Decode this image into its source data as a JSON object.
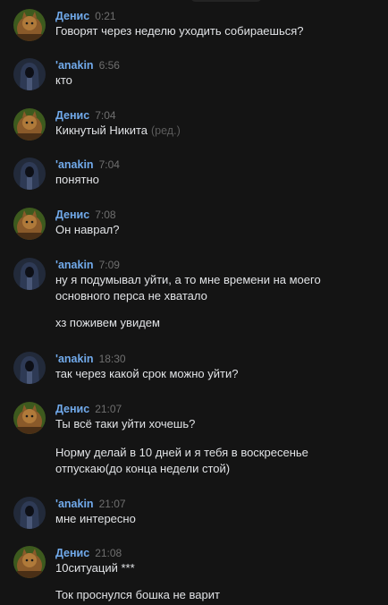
{
  "colors": {
    "background": "#141414",
    "author": "#71aaeb",
    "text": "#e1e3e6",
    "timestamp": "#6f6f6f"
  },
  "messages": [
    {
      "author": "Денис",
      "time": "0:21",
      "avatar": "cat-avatar",
      "lines": [
        "Говорят через неделю уходить собираешься?"
      ]
    },
    {
      "author": "'anakin",
      "time": "6:56",
      "avatar": "hooded-figure-avatar",
      "lines": [
        "кто"
      ]
    },
    {
      "author": "Денис",
      "time": "7:04",
      "avatar": "cat-avatar",
      "lines": [
        "Кикнутый Никита"
      ],
      "edited": "(ред.)"
    },
    {
      "author": "'anakin",
      "time": "7:04",
      "avatar": "hooded-figure-avatar",
      "lines": [
        "понятно"
      ]
    },
    {
      "author": "Денис",
      "time": "7:08",
      "avatar": "cat-avatar",
      "lines": [
        "Он наврал?"
      ]
    },
    {
      "author": "'anakin",
      "time": "7:09",
      "avatar": "hooded-figure-avatar",
      "lines": [
        "ну я подумывал уйти, а то мне времени на моего",
        "основного перса не хватало",
        "хз поживем увидем"
      ]
    },
    {
      "author": "'anakin",
      "time": "18:30",
      "avatar": "hooded-figure-avatar",
      "lines": [
        "так через какой срок можно уйти?"
      ]
    },
    {
      "author": "Денис",
      "time": "21:07",
      "avatar": "cat-avatar",
      "lines": [
        "Ты всё таки уйти хочешь?",
        "Норму делай в 10 дней и я тебя в воскресенье",
        "отпускаю(до конца недели стой)"
      ]
    },
    {
      "author": "'anakin",
      "time": "21:07",
      "avatar": "hooded-figure-avatar",
      "lines": [
        "мне интересно"
      ]
    },
    {
      "author": "Денис",
      "time": "21:08",
      "avatar": "cat-avatar",
      "lines": [
        "10ситуаций ***",
        "Ток проснулся бошка не варит"
      ]
    }
  ]
}
